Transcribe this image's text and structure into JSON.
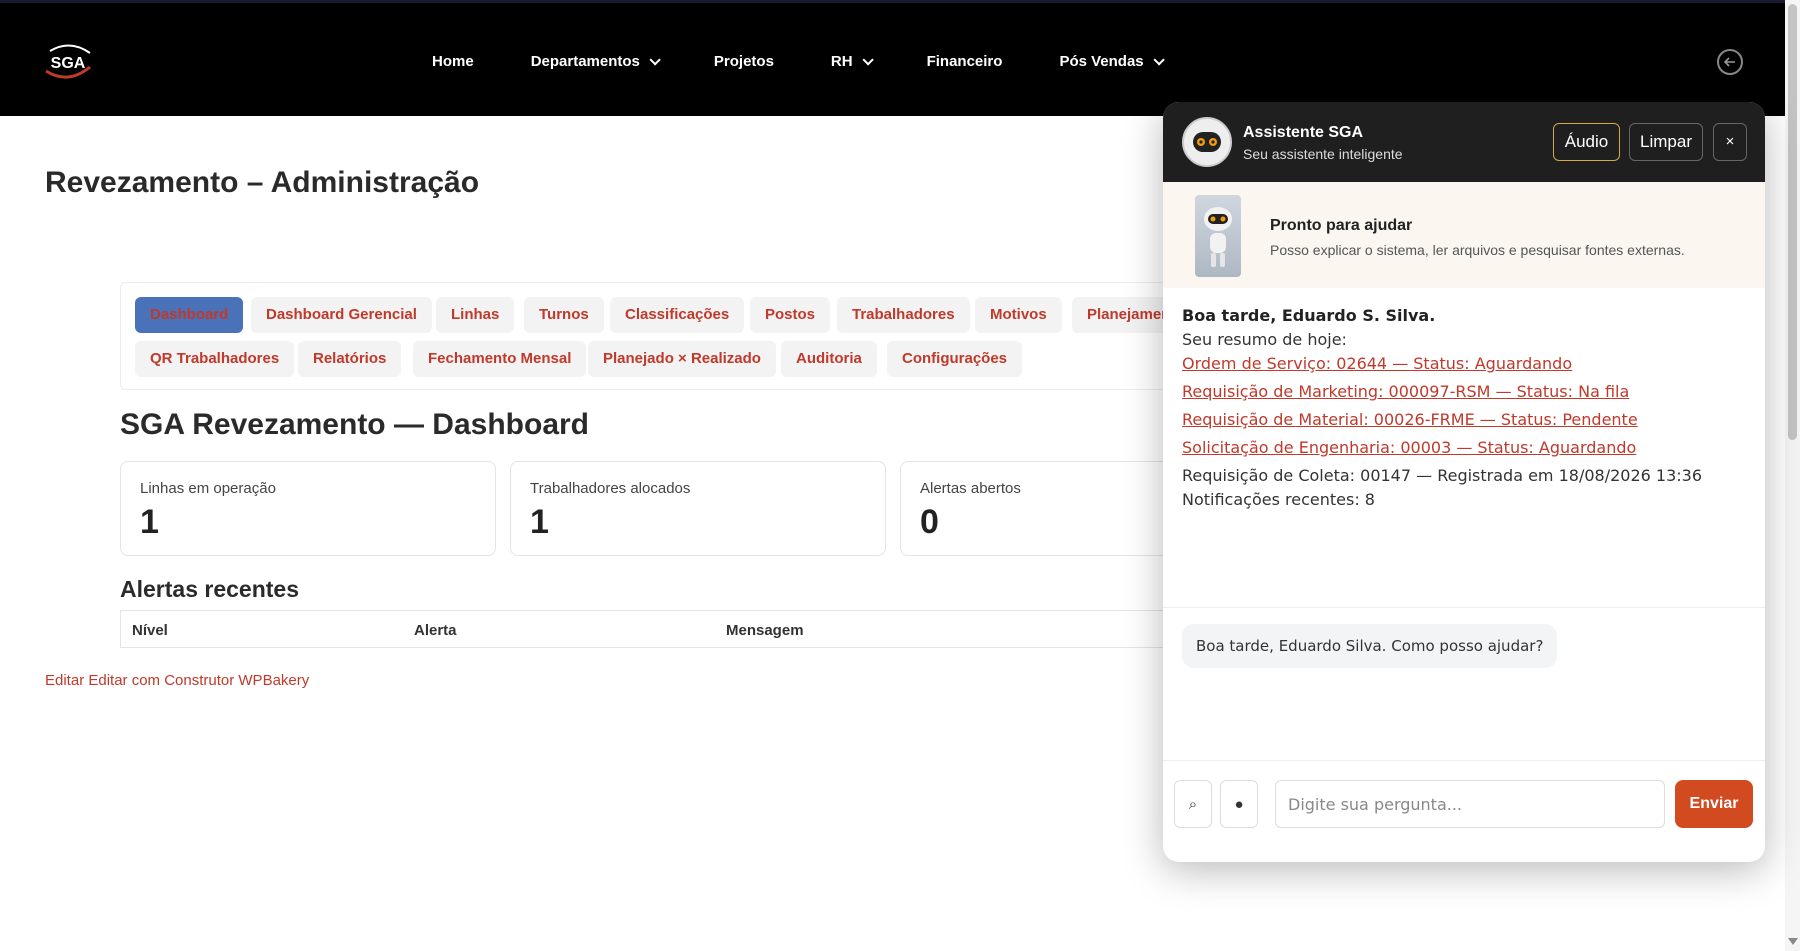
{
  "header": {
    "logo_text": "SGA",
    "nav": [
      {
        "label": "Home",
        "has_dropdown": false
      },
      {
        "label": "Departamentos",
        "has_dropdown": true
      },
      {
        "label": "Projetos",
        "has_dropdown": false
      },
      {
        "label": "RH",
        "has_dropdown": true
      },
      {
        "label": "Financeiro",
        "has_dropdown": false
      },
      {
        "label": "Pós Vendas",
        "has_dropdown": true
      }
    ]
  },
  "page": {
    "title": "Revezamento – Administração",
    "tabs_row1": [
      "Dashboard",
      "Dashboard Gerencial",
      "Linhas",
      "Turnos",
      "Classificações",
      "Postos",
      "Trabalhadores",
      "Motivos",
      "Planejamen"
    ],
    "tabs_row2": [
      "QR Trabalhadores",
      "Relatórios",
      "Fechamento Mensal",
      "Planejado × Realizado",
      "Auditoria",
      "Configurações"
    ],
    "active_tab": "Dashboard",
    "dashboard_title": "SGA Revezamento — Dashboard",
    "stats": [
      {
        "label": "Linhas em operação",
        "value": "1"
      },
      {
        "label": "Trabalhadores alocados",
        "value": "1"
      },
      {
        "label": "Alertas abertos",
        "value": "0"
      }
    ],
    "alerts_title": "Alertas recentes",
    "alerts_columns": [
      "Nível",
      "Alerta",
      "Mensagem"
    ],
    "edit_link": "Editar Editar com Construtor WPBakery"
  },
  "chat": {
    "name": "Assistente SGA",
    "subtitle": "Seu assistente inteligente",
    "audio_label": "Áudio",
    "clear_label": "Limpar",
    "close_label": "×",
    "ready_title": "Pronto para ajudar",
    "ready_subtitle": "Posso explicar o sistema, ler arquivos e pesquisar fontes externas.",
    "greeting": "Boa tarde, Eduardo S. Silva.",
    "summary_intro": "Seu resumo de hoje:",
    "summary_links": [
      "Ordem de Serviço: 02644 — Status: Aguardando",
      "Requisição de Marketing: 000097-RSM — Status: Na fila",
      "Requisição de Material: 00026-FRME — Status: Pendente",
      "Solicitação de Engenharia: 00003 — Status: Aguardando"
    ],
    "summary_lines": [
      "Requisição de Coleta: 00147 — Registrada em 18/08/2026 13:36",
      "Notificações recentes: 8"
    ],
    "bot_message": "Boa tarde, Eduardo Silva. Como posso ajudar?",
    "search_glyph": "⌕",
    "record_glyph": "●",
    "input_placeholder": "Digite sua pergunta...",
    "send_label": "Enviar"
  },
  "colors": {
    "accent": "#c0392b",
    "active_tab_bg": "#4a72b8",
    "send_button": "#d24a1f",
    "header_bg": "#000000"
  }
}
